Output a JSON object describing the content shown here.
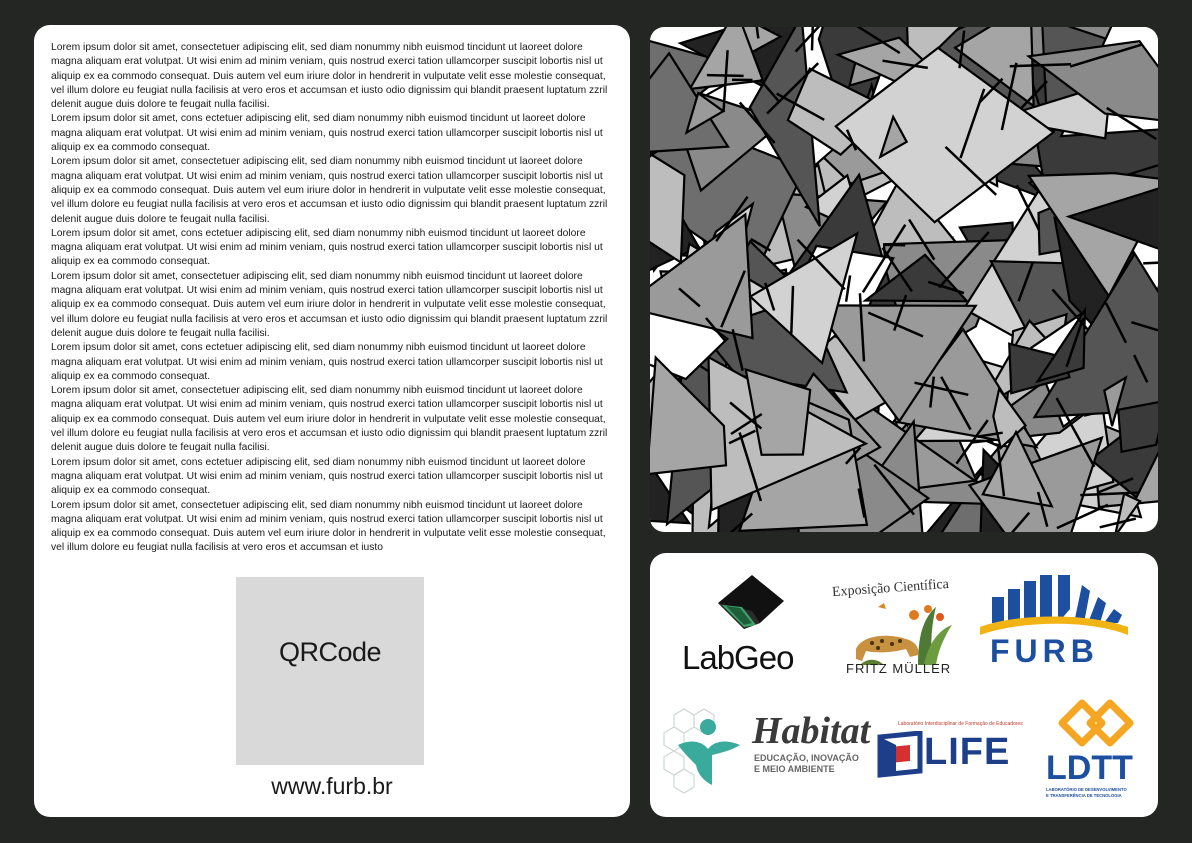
{
  "body_paragraphs": [
    "Lorem ipsum dolor sit amet, consectetuer adipiscing elit, sed diam nonummy nibh euismod tincidunt ut laoreet dolore magna aliquam erat volutpat. Ut wisi enim ad minim veniam, quis nostrud exerci tation ullamcorper suscipit lobortis nisl ut aliquip ex ea commodo consequat. Duis autem vel eum iriure dolor in hendrerit in vulputate velit esse molestie consequat, vel illum dolore eu feugiat nulla facilisis at vero eros et accumsan et iusto odio dignissim qui blandit praesent luptatum zzril delenit augue duis dolore te feugait nulla facilisi.",
    "Lorem ipsum dolor sit amet, cons ectetuer adipiscing elit, sed diam nonummy nibh euismod tincidunt ut laoreet dolore magna aliquam erat volutpat. Ut wisi enim ad minim veniam, quis nostrud exerci tation ullamcorper suscipit lobortis nisl ut aliquip ex ea commodo consequat.",
    "Lorem ipsum dolor sit amet, consectetuer adipiscing elit, sed diam nonummy nibh euismod tincidunt ut laoreet dolore magna aliquam erat volutpat. Ut wisi enim ad minim veniam, quis nostrud exerci tation ullamcorper suscipit lobortis nisl ut aliquip ex ea commodo consequat. Duis autem vel eum iriure dolor in hendrerit in vulputate velit esse molestie consequat, vel illum dolore eu feugiat nulla facilisis at vero eros et accumsan et iusto odio dignissim qui blandit praesent luptatum zzril delenit augue duis dolore te feugait nulla facilisi.",
    "Lorem ipsum dolor sit amet, cons ectetuer adipiscing elit, sed diam nonummy nibh euismod tincidunt ut laoreet dolore magna aliquam erat volutpat. Ut wisi enim ad minim veniam, quis nostrud exerci tation ullamcorper suscipit lobortis nisl ut aliquip ex ea commodo consequat.",
    "Lorem ipsum dolor sit amet, consectetuer adipiscing elit, sed diam nonummy nibh euismod tincidunt ut laoreet dolore magna aliquam erat volutpat. Ut wisi enim ad minim veniam, quis nostrud exerci tation ullamcorper suscipit lobortis nisl ut aliquip ex ea commodo consequat. Duis autem vel eum iriure dolor in hendrerit in vulputate velit esse molestie consequat, vel illum dolore eu feugiat nulla facilisis at vero eros et accumsan et iusto odio dignissim qui blandit praesent luptatum zzril delenit augue duis dolore te feugait nulla facilisi.",
    "Lorem ipsum dolor sit amet, cons ectetuer adipiscing elit, sed diam nonummy nibh euismod tincidunt ut laoreet dolore magna aliquam erat volutpat. Ut wisi enim ad minim veniam, quis nostrud exerci tation ullamcorper suscipit lobortis nisl ut aliquip ex ea commodo consequat.",
    "Lorem ipsum dolor sit amet, consectetuer adipiscing elit, sed diam nonummy nibh euismod tincidunt ut laoreet dolore magna aliquam erat volutpat. Ut wisi enim ad minim veniam, quis nostrud exerci tation ullamcorper suscipit lobortis nisl ut aliquip ex ea commodo consequat. Duis autem vel eum iriure dolor in hendrerit in vulputate velit esse molestie consequat, vel illum dolore eu feugiat nulla facilisis at vero eros et accumsan et iusto odio dignissim qui blandit praesent luptatum zzril delenit augue duis dolore te feugait nulla facilisi.",
    "Lorem ipsum dolor sit amet, cons ectetuer adipiscing elit, sed diam nonummy nibh euismod tincidunt ut laoreet dolore magna aliquam erat volutpat. Ut wisi enim ad minim veniam, quis nostrud exerci tation ullamcorper suscipit lobortis nisl ut aliquip ex ea commodo consequat.",
    "Lorem ipsum dolor sit amet, consectetuer adipiscing elit, sed diam nonummy nibh euismod tincidunt ut laoreet dolore magna aliquam erat volutpat. Ut wisi enim ad minim veniam, quis nostrud exerci tation ullamcorper suscipit lobortis nisl ut aliquip ex ea commodo consequat. Duis autem vel eum iriure dolor in hendrerit in vulputate velit esse molestie consequat, vel illum dolore eu feugiat nulla facilisis at vero eros et accumsan et iusto"
  ],
  "qr_placeholder": "QRCode",
  "website": "www.furb.br",
  "logos": {
    "labgeo": {
      "name": "LabGeo",
      "icon": "labgeo-cube-icon"
    },
    "expo": {
      "arc_text": "Exposição Científica",
      "sub_text": "FRITZ MÜLLER",
      "icon": "jaguar-plants-icon"
    },
    "furb": {
      "name": "FURB",
      "icon": "furb-building-icon",
      "colors": {
        "blue": "#1d4fa0",
        "yellow": "#f2b315"
      }
    },
    "habitat": {
      "name": "Habitat",
      "tagline_1": "EDUCAÇÃO, INOVAÇÃO",
      "tagline_2": "E MEIO AMBIENTE",
      "icon": "habitat-figure-icon",
      "color": "#3aaa9c"
    },
    "life": {
      "name": "LIFE",
      "tagline": "Laboratório Interdisciplinar de Formação de Educadores",
      "icon": "life-frame-icon"
    },
    "ldtt": {
      "name": "LDTT",
      "tagline_1": "LABORATÓRIO DE DESENVOLVIMENTO",
      "tagline_2": "E TRANSFERÊNCIA DE TECNOLOGIA",
      "icon": "chain-link-icon",
      "color_orange": "#f5a623",
      "color_blue": "#1d4fa0"
    }
  },
  "colors": {
    "background": "#232623",
    "panel": "#ffffff",
    "qr_box": "#d9d9d9"
  }
}
